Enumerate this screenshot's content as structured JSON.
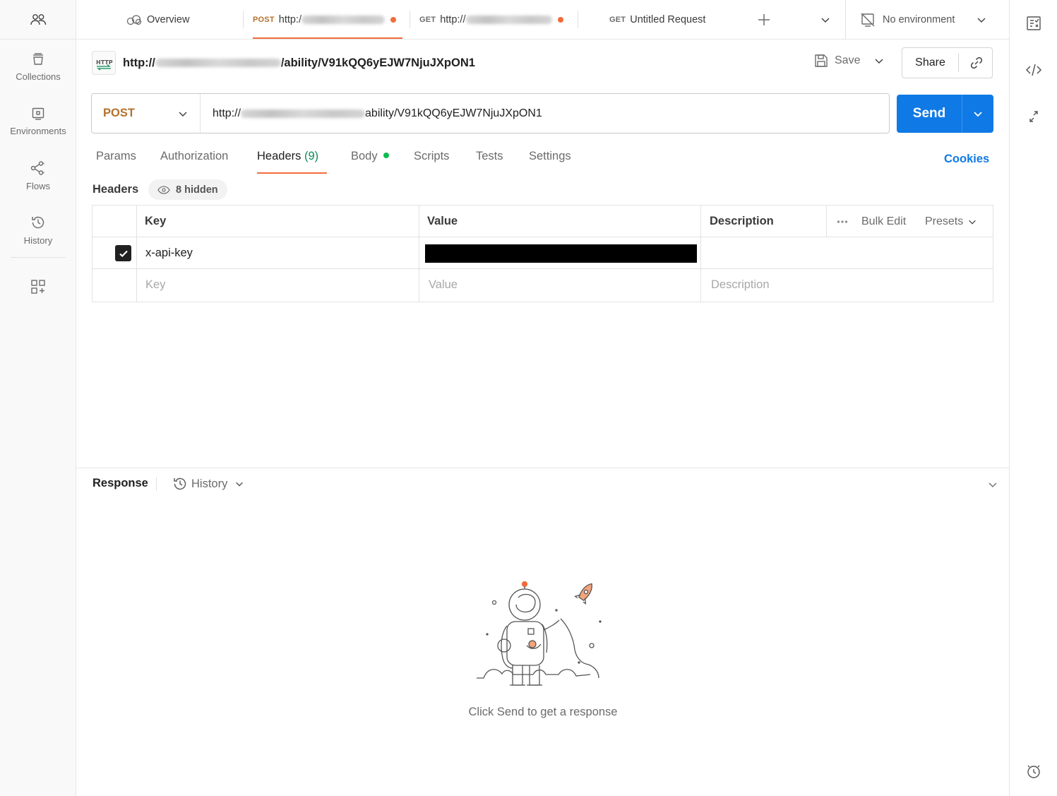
{
  "tabs": {
    "overview": "Overview",
    "tab1": {
      "method": "POST",
      "url": "http:/"
    },
    "tab2": {
      "method": "GET",
      "url": "http://"
    },
    "tab3": {
      "method": "GET",
      "name": "Untitled Request"
    },
    "environment": "No environment"
  },
  "sidebar": {
    "items": [
      {
        "label": "Collections"
      },
      {
        "label": "Environments"
      },
      {
        "label": "Flows"
      },
      {
        "label": "History"
      }
    ]
  },
  "request": {
    "title_prefix": "http://",
    "title_suffix": "/ability/V91kQQ6yEJW7NjuJXpON1",
    "save_label": "Save",
    "share_label": "Share",
    "method": "POST",
    "url_prefix": "http://",
    "url_suffix": "ability/V91kQQ6yEJW7NjuJXpON1",
    "send_label": "Send",
    "tabs": [
      "Params",
      "Authorization",
      "Headers",
      "Body",
      "Scripts",
      "Tests",
      "Settings"
    ],
    "headers_count": "(9)",
    "cookies_label": "Cookies"
  },
  "headers": {
    "label": "Headers",
    "hidden": "8 hidden",
    "columns": {
      "key": "Key",
      "value": "Value",
      "description": "Description"
    },
    "bulk_edit": "Bulk Edit",
    "presets": "Presets",
    "rows": [
      {
        "key": "x-api-key",
        "value": "",
        "description": "",
        "checked": true
      }
    ],
    "placeholders": {
      "key": "Key",
      "value": "Value",
      "description": "Description"
    }
  },
  "response": {
    "label": "Response",
    "history": "History",
    "empty_message": "Click Send to get a response"
  },
  "colors": {
    "accent": "#f26b3a",
    "send": "#0f7ae5",
    "post_method": "#b5712c",
    "count_green": "#0a8a5a"
  },
  "icons": [
    "team-icon",
    "collections-icon",
    "environments-icon",
    "flows-icon",
    "history-icon",
    "apps-icon",
    "cloud-icon",
    "plus-icon",
    "chevron-down-icon",
    "no-env-icon",
    "save-icon",
    "link-icon",
    "eye-icon",
    "checkmark-icon",
    "http-icon",
    "code-icon",
    "info-icon",
    "expand-icon",
    "help-icon"
  ]
}
